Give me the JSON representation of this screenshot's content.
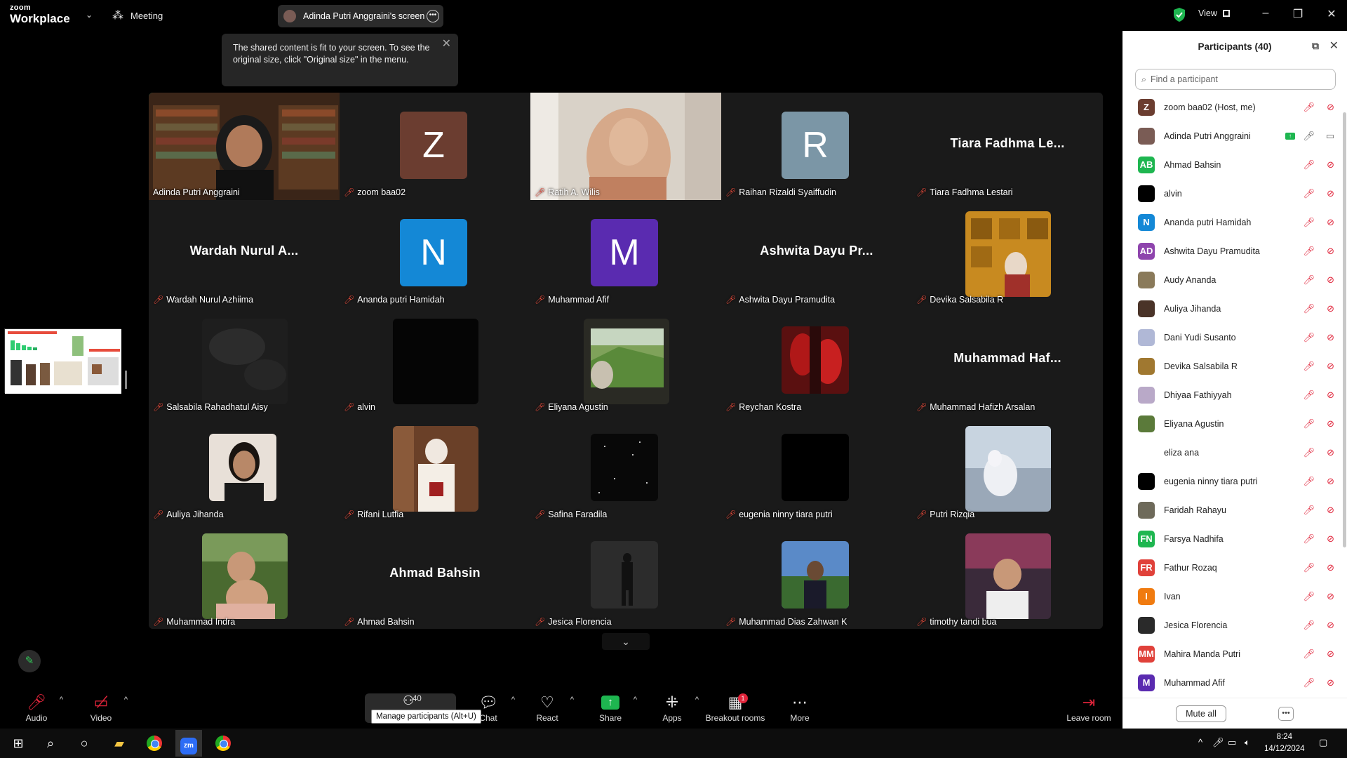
{
  "titlebar": {
    "logo_top": "zoom",
    "logo_bottom": "Workplace",
    "meeting_label": "Meeting",
    "share_pill_label": "Adinda Putri Anggraini's screen",
    "view_label": "View"
  },
  "fit_tip": {
    "text": "The shared content is fit to your screen. To see the original size, click \"Original size\" in the menu."
  },
  "tiles": [
    {
      "name": "Adinda Putri Anggraini",
      "kind": "video",
      "muted": false,
      "active": true
    },
    {
      "name": "zoom baa02",
      "kind": "avatar",
      "letter": "Z",
      "color": "#6b3d30",
      "muted": true
    },
    {
      "name": "Ratih A. Wilis",
      "kind": "video",
      "muted": true
    },
    {
      "name": "Raihan Rizaldi Syaiffudin",
      "kind": "avatar",
      "letter": "R",
      "color": "#7b96a6",
      "muted": true
    },
    {
      "name": "Tiara Fadhma Lestari",
      "kind": "text",
      "big": "Tiara Fadhma Le...",
      "muted": true
    },
    {
      "name": "Wardah Nurul Azhiima",
      "kind": "text",
      "big": "Wardah Nurul A...",
      "muted": true
    },
    {
      "name": "Ananda putri Hamidah",
      "kind": "avatar",
      "letter": "N",
      "color": "#1488d6",
      "muted": true
    },
    {
      "name": "Muhammad Afif",
      "kind": "avatar",
      "letter": "M",
      "color": "#5a2bb0",
      "muted": true
    },
    {
      "name": "Ashwita Dayu Pramudita",
      "kind": "text",
      "big": "Ashwita Dayu Pr...",
      "muted": true
    },
    {
      "name": "Devika Salsabila R",
      "kind": "photo",
      "muted": true
    },
    {
      "name": "Salsabila Rahadhatul Aisy",
      "kind": "photo",
      "muted": true
    },
    {
      "name": "alvin",
      "kind": "photo",
      "muted": true
    },
    {
      "name": "Eliyana Agustin",
      "kind": "photo",
      "muted": true
    },
    {
      "name": "Reychan Kostra",
      "kind": "photo-sm",
      "muted": true
    },
    {
      "name": "Muhammad Hafizh Arsalan",
      "kind": "text",
      "big": "Muhammad Haf...",
      "muted": true
    },
    {
      "name": "Auliya Jihanda",
      "kind": "photo-sm",
      "muted": true
    },
    {
      "name": "Rifani Lutfia",
      "kind": "photo",
      "muted": true
    },
    {
      "name": "Safina Faradila",
      "kind": "photo-sm",
      "muted": true
    },
    {
      "name": "eugenia ninny tiara putri",
      "kind": "photo-sm",
      "muted": true
    },
    {
      "name": "Putri Rizqia",
      "kind": "photo",
      "muted": true
    },
    {
      "name": "Muhammad Indra",
      "kind": "photo",
      "muted": true
    },
    {
      "name": "Ahmad Bahsin",
      "kind": "text",
      "big": "Ahmad Bahsin",
      "muted": true
    },
    {
      "name": "Jesica Florencia",
      "kind": "photo-sm",
      "muted": true
    },
    {
      "name": "Muhammad Dias Zahwan K",
      "kind": "photo-sm",
      "muted": true
    },
    {
      "name": "timothy tandi bua",
      "kind": "photo",
      "muted": true
    }
  ],
  "panel": {
    "title": "Participants (40)",
    "search_placeholder": "Find a participant",
    "participants": [
      {
        "name": "zoom baa02 (Host, me)",
        "avatar": "Z",
        "color": "#6b3d30"
      },
      {
        "name": "Adinda Putri Anggraini",
        "avatar": "",
        "color": "#7a5c55",
        "sharing": true
      },
      {
        "name": "Ahmad Bahsin",
        "avatar": "AB",
        "color": "#1eb650"
      },
      {
        "name": "alvin",
        "avatar": "",
        "color": "#000000"
      },
      {
        "name": "Ananda putri Hamidah",
        "avatar": "N",
        "color": "#1488d6"
      },
      {
        "name": "Ashwita Dayu Pramudita",
        "avatar": "AD",
        "color": "#8e44ad"
      },
      {
        "name": "Audy Ananda",
        "avatar": "",
        "color": "#8a7a5a"
      },
      {
        "name": "Auliya Jihanda",
        "avatar": "",
        "color": "#4a3328"
      },
      {
        "name": "Dani Yudi Susanto",
        "avatar": "",
        "color": "#b0b8d6"
      },
      {
        "name": "Devika Salsabila R",
        "avatar": "",
        "color": "#a07830"
      },
      {
        "name": "Dhiyaa Fathiyyah",
        "avatar": "",
        "color": "#b9a9c8"
      },
      {
        "name": "Eliyana Agustin",
        "avatar": "",
        "color": "#5b7a3a"
      },
      {
        "name": "eliza ana",
        "avatar": "",
        "color": "#ffffff"
      },
      {
        "name": "eugenia ninny tiara putri",
        "avatar": "",
        "color": "#000000"
      },
      {
        "name": "Faridah Rahayu",
        "avatar": "",
        "color": "#6e6a5a"
      },
      {
        "name": "Farsya Nadhifa",
        "avatar": "FN",
        "color": "#1eb650"
      },
      {
        "name": "Fathur Rozaq",
        "avatar": "FR",
        "color": "#e0413a"
      },
      {
        "name": "Ivan",
        "avatar": "I",
        "color": "#f07b10"
      },
      {
        "name": "Jesica Florencia",
        "avatar": "",
        "color": "#2a2a2a"
      },
      {
        "name": "Mahira Manda Putri",
        "avatar": "MM",
        "color": "#e0413a"
      },
      {
        "name": "Muhammad Afif",
        "avatar": "M",
        "color": "#5a2bb0"
      }
    ],
    "mute_all": "Mute all"
  },
  "toolbar": {
    "audio": "Audio",
    "video": "Video",
    "participants_count": "40",
    "participants_tooltip": "Manage participants (Alt+U)",
    "chat": "Chat",
    "react": "React",
    "share": "Share",
    "apps": "Apps",
    "breakout": "Breakout rooms",
    "breakout_badge": "1",
    "more": "More",
    "leave": "Leave room"
  },
  "taskbar": {
    "time": "8:24",
    "date": "14/12/2024"
  },
  "colors": {
    "active_speaker": "#23d18b",
    "muted_red": "#e0243a",
    "share_green": "#1eb650"
  }
}
